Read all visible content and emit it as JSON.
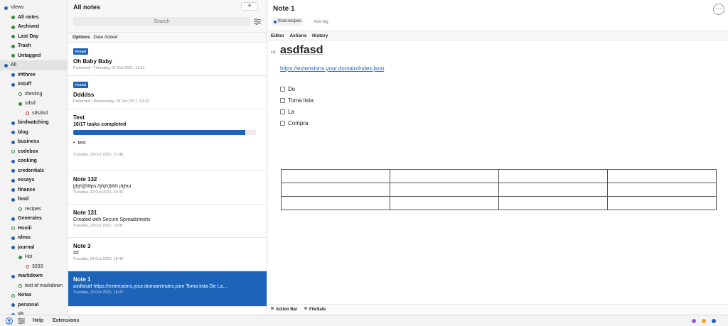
{
  "sidebar": {
    "tags": [
      {
        "label": "Views",
        "indent": 0,
        "dot": "filled",
        "bold": false
      },
      {
        "label": "All notes",
        "indent": 1,
        "dot": "green",
        "bold": true
      },
      {
        "label": "Archived",
        "indent": 1,
        "dot": "green",
        "bold": true
      },
      {
        "label": "Last Day",
        "indent": 1,
        "dot": "green",
        "bold": true
      },
      {
        "label": "Trash",
        "indent": 1,
        "dot": "green",
        "bold": true
      },
      {
        "label": "Untagged",
        "indent": 1,
        "dot": "green",
        "bold": true
      },
      {
        "label": "All",
        "indent": 0,
        "dot": "filled",
        "bold": false,
        "selected": true
      },
      {
        "label": "##three",
        "indent": 1,
        "dot": "filled",
        "bold": true
      },
      {
        "label": "#stuff",
        "indent": 1,
        "dot": "filled",
        "bold": true
      },
      {
        "label": "#testing",
        "indent": 2,
        "dot": "outline",
        "bold": false
      },
      {
        "label": "sdsd",
        "indent": 2,
        "dot": "green",
        "bold": false
      },
      {
        "label": "sdsdsd",
        "indent": 3,
        "dot": "outline-red",
        "bold": false
      },
      {
        "label": "birdwatching",
        "indent": 1,
        "dot": "filled",
        "bold": true
      },
      {
        "label": "blog",
        "indent": 1,
        "dot": "filled",
        "bold": true
      },
      {
        "label": "business",
        "indent": 1,
        "dot": "filled",
        "bold": true
      },
      {
        "label": "codebox",
        "indent": 1,
        "dot": "outline",
        "bold": true
      },
      {
        "label": "cooking",
        "indent": 1,
        "dot": "filled",
        "bold": true
      },
      {
        "label": "credentials",
        "indent": 1,
        "dot": "filled",
        "bold": true
      },
      {
        "label": "essays",
        "indent": 1,
        "dot": "filled",
        "bold": true
      },
      {
        "label": "finance",
        "indent": 1,
        "dot": "filled",
        "bold": true
      },
      {
        "label": "food",
        "indent": 1,
        "dot": "filled",
        "bold": true
      },
      {
        "label": "recipes",
        "indent": 2,
        "dot": "outline",
        "bold": false
      },
      {
        "label": "Generales",
        "indent": 1,
        "dot": "filled",
        "bold": true
      },
      {
        "label": "Hooiii",
        "indent": 1,
        "dot": "outline",
        "bold": true
      },
      {
        "label": "ideas",
        "indent": 1,
        "dot": "filled",
        "bold": true
      },
      {
        "label": "journal",
        "indent": 1,
        "dot": "filled",
        "bold": true
      },
      {
        "label": "Hoi",
        "indent": 2,
        "dot": "green",
        "bold": false
      },
      {
        "label": "3333",
        "indent": 3,
        "dot": "outline-red",
        "bold": false
      },
      {
        "label": "markdown",
        "indent": 1,
        "dot": "filled",
        "bold": true
      },
      {
        "label": "test of markdown",
        "indent": 2,
        "dot": "outline",
        "bold": false
      },
      {
        "label": "Notas",
        "indent": 1,
        "dot": "outline",
        "bold": true
      },
      {
        "label": "personal",
        "indent": 1,
        "dot": "filled",
        "bold": true
      },
      {
        "label": "sb",
        "indent": 1,
        "dot": "filled",
        "bold": true
      }
    ]
  },
  "bottom_bar": {
    "help": "Help",
    "extensions": "Extensions",
    "status_colors": [
      "#8e5bd6",
      "#f0a030",
      "#1d63b8"
    ]
  },
  "notes_list": {
    "title": "All notes",
    "add_label": "+",
    "search_placeholder": "Search",
    "options_label": "Options",
    "sort_label": "Date Added",
    "notes": [
      {
        "pinned": "Pinned",
        "title": "Oh Baby Baby",
        "preview": "",
        "date": "Protected • Thursday, 07 Oct 2021, 11:51"
      },
      {
        "pinned": "Pinned",
        "title": "Ddddss",
        "preview": "",
        "date": "Protected • Wednesday, 18 Oct 2017, 02:32"
      },
      {
        "pinned": "",
        "title": "Test",
        "tasks": "16/17 tasks completed",
        "progress": 0.94,
        "bullet": "test",
        "date": "Tuesday, 19 Oct 2021, 21:49"
      },
      {
        "pinned": "",
        "title": "Note 132",
        "preview": "[jhjh](https://jhjh)bhh jhjhui",
        "date": "Tuesday, 19 Oct 2021, 20:31"
      },
      {
        "pinned": "",
        "title": "Note 131",
        "preview": "Created with Secure Spreadsheets",
        "date": "Tuesday, 19 Oct 2021, 19:47"
      },
      {
        "pinned": "",
        "title": "Note 3",
        "preview": "##",
        "date": "Tuesday, 19 Oct 2021, 18:42"
      },
      {
        "pinned": "",
        "title": "Note 1",
        "preview": "asdfasdf https://extensions.your.domain/index.json Toma lista De La...",
        "date": "Tuesday, 19 Oct 2021, 18:22",
        "active": true
      }
    ]
  },
  "editor": {
    "title": "Note 1",
    "more_label": "···",
    "tag_chip": "food.recipes",
    "add_tag_placeholder": "Add tag",
    "tabs": [
      "Editor",
      "Actions",
      "History"
    ],
    "h1_marker": "H1",
    "heading": "asdfasd",
    "link": "https://extensions.your.domain/index.json",
    "todos": [
      "De",
      "Toma lista",
      "La",
      "Compra"
    ],
    "table_rows": 3,
    "table_cols": 4,
    "footer_items": [
      "Action Bar",
      "FileSafe"
    ]
  },
  "colors": {
    "accent": "#1d63b8",
    "sidebar_bg": "#f3f3f3"
  }
}
